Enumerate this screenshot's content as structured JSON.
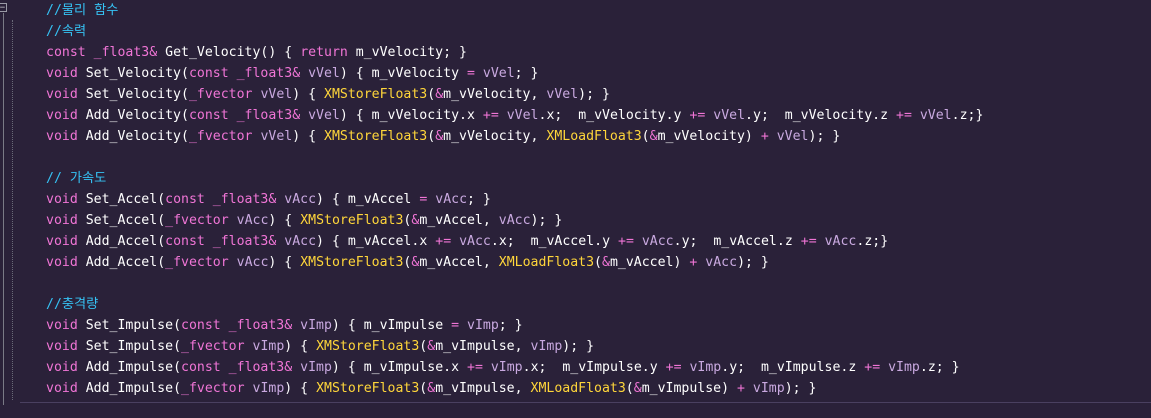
{
  "comments": {
    "physics": "//물리 함수",
    "velocity": "//속력",
    "accel": "// 가속도",
    "impulse": "//충격량"
  },
  "code_lines": {
    "velocity": [
      "const _float3& Get_Velocity() { return m_vVelocity; }",
      "void Set_Velocity(const _float3& vVel) { m_vVelocity = vVel; }",
      "void Set_Velocity(_fvector vVel) { XMStoreFloat3(&m_vVelocity, vVel); }",
      "void Add_Velocity(const _float3& vVel) { m_vVelocity.x += vVel.x;  m_vVelocity.y += vVel.y;  m_vVelocity.z += vVel.z;}",
      "void Add_Velocity(_fvector vVel) { XMStoreFloat3(&m_vVelocity, XMLoadFloat3(&m_vVelocity) + vVel); }"
    ],
    "accel": [
      "void Set_Accel(const _float3& vAcc) { m_vAccel = vAcc; }",
      "void Set_Accel(_fvector vAcc) { XMStoreFloat3(&m_vAccel, vAcc); }",
      "void Add_Accel(const _float3& vAcc) { m_vAccel.x += vAcc.x;  m_vAccel.y += vAcc.y;  m_vAccel.z += vAcc.z;}",
      "void Add_Accel(_fvector vAcc) { XMStoreFloat3(&m_vAccel, XMLoadFloat3(&m_vAccel) + vAcc); }"
    ],
    "impulse": [
      "void Set_Impulse(const _float3& vImp) { m_vImpulse = vImp; }",
      "void Set_Impulse(_fvector vImp) { XMStoreFloat3(&m_vImpulse, vImp); }",
      "void Add_Impulse(const _float3& vImp) { m_vImpulse.x += vImp.x;  m_vImpulse.y += vImp.y;  m_vImpulse.z += vImp.z; }",
      "void Add_Impulse(_fvector vImp) { XMStoreFloat3(&m_vImpulse, XMLoadFloat3(&m_vImpulse) + vImp); }"
    ]
  },
  "fold_symbol": "−",
  "colors": {
    "background": "#2a2139",
    "comment": "#36c2f4",
    "keyword": "#f075d6",
    "type": "#ffd63a",
    "parameter": "#c9a9e0",
    "default": "#ffffff"
  }
}
